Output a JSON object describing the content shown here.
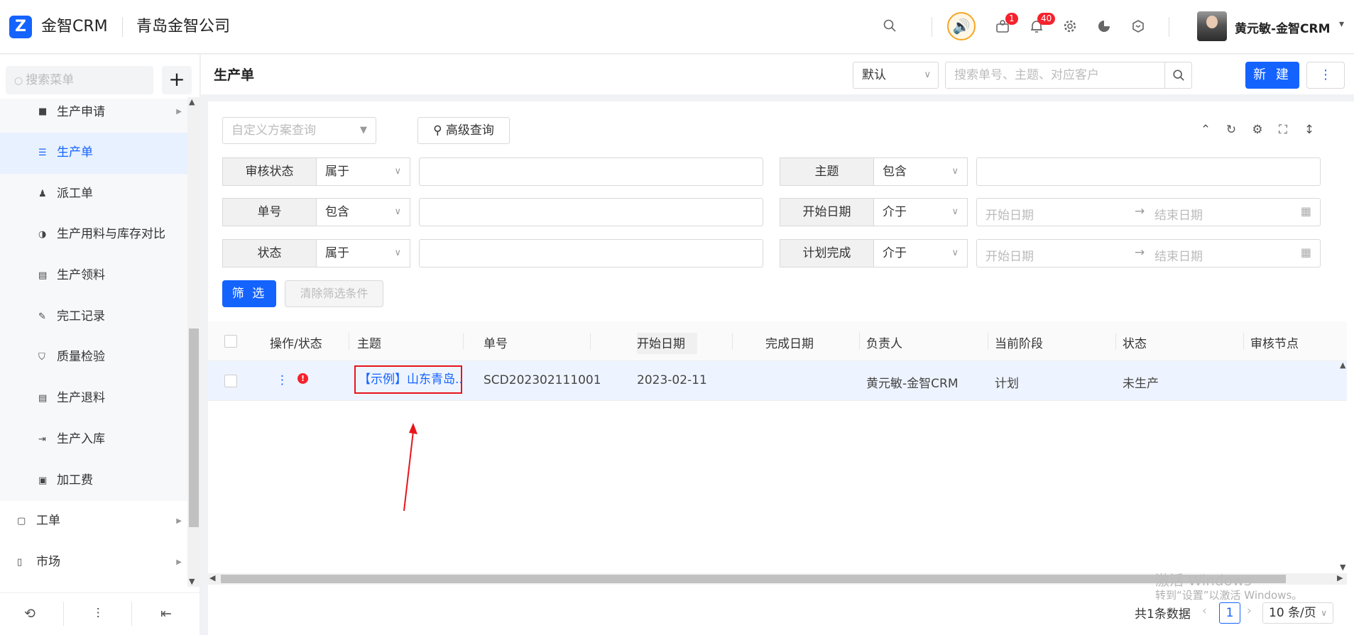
{
  "topbar": {
    "logo": "Z",
    "brand": "金智CRM",
    "company": "青岛金智公司",
    "badges": {
      "inbox": "1",
      "notifications": "40"
    },
    "user": "黄元敏-金智CRM"
  },
  "sidebar": {
    "search_placeholder": "搜索菜单",
    "add": "+",
    "items": [
      {
        "label": "生产申请",
        "icon": "folder-icon"
      },
      {
        "label": "生产单",
        "icon": "list-icon"
      },
      {
        "label": "派工单",
        "icon": "worker-icon"
      },
      {
        "label": "生产用料与库存对比",
        "icon": "halfcircle-icon"
      },
      {
        "label": "生产领料",
        "icon": "doc-icon"
      },
      {
        "label": "完工记录",
        "icon": "edit-icon"
      },
      {
        "label": "质量检验",
        "icon": "shield-icon"
      },
      {
        "label": "生产退料",
        "icon": "doc-icon"
      },
      {
        "label": "生产入库",
        "icon": "import-icon"
      },
      {
        "label": "加工费",
        "icon": "money-icon"
      }
    ],
    "groups": [
      {
        "label": "工单",
        "icon": "doc-icon"
      },
      {
        "label": "市场",
        "icon": "bookmark-icon"
      }
    ]
  },
  "page": {
    "title": "生产单",
    "view_select": "默认",
    "search_placeholder": "搜索单号、主题、对应客户",
    "new_label": "新 建",
    "more": "⋮"
  },
  "filter": {
    "custom_placeholder": "自定义方案查询",
    "advanced": "高级查询",
    "rows": [
      {
        "label": "审核状态",
        "op": "属于"
      },
      {
        "label": "单号",
        "op": "包含"
      },
      {
        "label": "状态",
        "op": "属于"
      },
      {
        "label": "主题",
        "op": "包含"
      },
      {
        "label": "开始日期",
        "op": "介于",
        "start": "开始日期",
        "end": "结束日期"
      },
      {
        "label": "计划完成",
        "op": "介于",
        "start": "开始日期",
        "end": "结束日期"
      }
    ],
    "filter_btn": "筛 选",
    "clear_btn": "清除筛选条件"
  },
  "table": {
    "columns": [
      "操作/状态",
      "主题",
      "单号",
      "开始日期",
      "完成日期",
      "负责人",
      "当前阶段",
      "状态",
      "审核节点"
    ],
    "rows": [
      {
        "subject": "【示例】山东青岛...",
        "number": "SCD202302111001",
        "start": "2023-02-11",
        "finish": "",
        "owner": "黄元敏-金智CRM",
        "stage": "计划",
        "status": "未生产",
        "node": ""
      }
    ]
  },
  "pagination": {
    "total": "共1条数据",
    "page": "1",
    "size": "10 条/页"
  },
  "watermark": {
    "line1": "激活 Windows",
    "line2": "转到“设置”以激活 Windows。"
  },
  "colors": {
    "accent": "#1463ff",
    "highlight": "#e8141b"
  }
}
